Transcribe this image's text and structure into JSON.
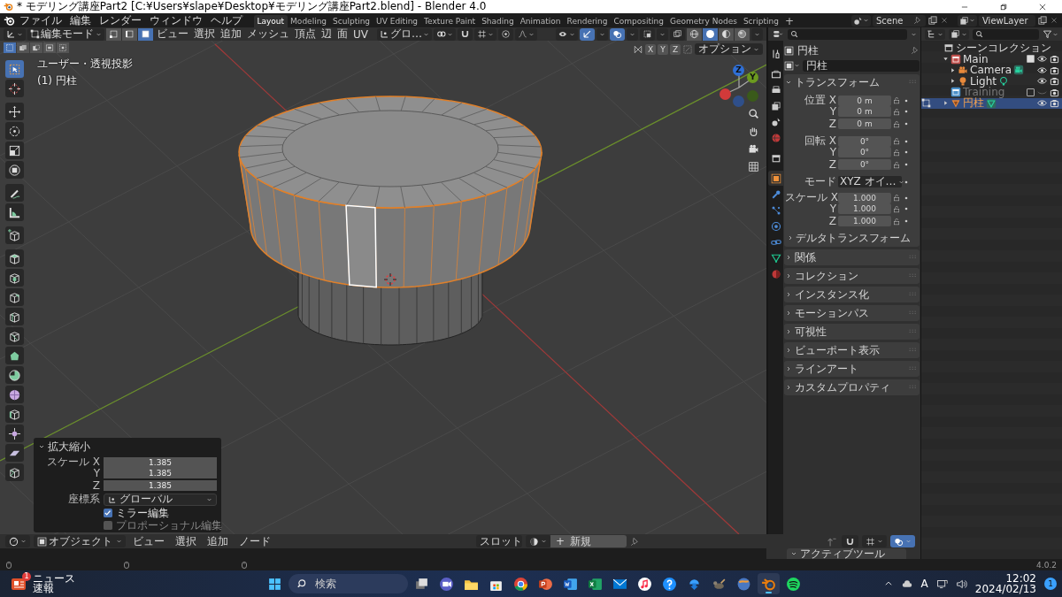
{
  "window": {
    "title": "* モデリング講座Part2 [C:¥Users¥slape¥Desktop¥モデリング講座Part2.blend] - Blender 4.0"
  },
  "menu": [
    "ファイル",
    "編集",
    "レンダー",
    "ウィンドウ",
    "ヘルプ"
  ],
  "workspaces": [
    {
      "label": "Layout",
      "selected": true
    },
    {
      "label": "Modeling",
      "selected": false
    },
    {
      "label": "Sculpting",
      "selected": false
    },
    {
      "label": "UV Editing",
      "selected": false
    },
    {
      "label": "Texture Paint",
      "selected": false
    },
    {
      "label": "Shading",
      "selected": false
    },
    {
      "label": "Animation",
      "selected": false
    },
    {
      "label": "Rendering",
      "selected": false
    },
    {
      "label": "Compositing",
      "selected": false
    },
    {
      "label": "Geometry Nodes",
      "selected": false
    },
    {
      "label": "Scripting",
      "selected": false
    }
  ],
  "add_workspace": "+",
  "scene": {
    "name": "Scene"
  },
  "view_layer": {
    "name": "ViewLayer"
  },
  "viewport_header": {
    "mode": "編集モード",
    "select_modes": [
      {
        "kind": "vertex",
        "selected": false
      },
      {
        "kind": "edge",
        "selected": false
      },
      {
        "kind": "face",
        "selected": true
      }
    ],
    "menus": [
      "ビュー",
      "選択",
      "追加",
      "メッシュ",
      "頂点",
      "辺",
      "面",
      "UV"
    ],
    "orientation": "グロ…",
    "left_toggles": [
      {
        "kind": "snap",
        "on": false
      },
      {
        "kind": "proportional",
        "on": false
      }
    ],
    "right_toggles": [
      {
        "kind": "gizmo",
        "on": true
      },
      {
        "kind": "overlay",
        "on": true
      },
      {
        "kind": "mesh_overlay",
        "on": false
      },
      {
        "kind": "xray",
        "on": false
      }
    ],
    "shading": [
      {
        "kind": "wireframe",
        "selected": false
      },
      {
        "kind": "solid",
        "selected": true
      },
      {
        "kind": "material",
        "selected": false
      },
      {
        "kind": "rendered",
        "selected": false
      }
    ],
    "box_modes": [
      {
        "kind": "set",
        "selected": true
      },
      {
        "kind": "extend",
        "selected": false
      },
      {
        "kind": "subtract",
        "selected": false
      },
      {
        "kind": "invert",
        "selected": false
      },
      {
        "kind": "intersect",
        "selected": false
      }
    ],
    "mirror_axes": [
      {
        "label": "X",
        "on": false
      },
      {
        "label": "Y",
        "on": false
      },
      {
        "label": "Z",
        "on": false
      }
    ],
    "options": "オプション"
  },
  "viewport": {
    "view_name": "ユーザー・透視投影",
    "object_label": "(1) 円柱",
    "gizmo_labels": [
      "Z",
      "Y"
    ]
  },
  "tool_groups": [
    [
      {
        "kind": "select_box",
        "selected": true
      },
      {
        "kind": "cursor",
        "selected": false
      }
    ],
    [
      {
        "kind": "move",
        "selected": false
      },
      {
        "kind": "rotate",
        "selected": false
      },
      {
        "kind": "scale",
        "selected": false
      },
      {
        "kind": "transform",
        "selected": false
      }
    ],
    [
      {
        "kind": "annotate",
        "selected": false
      },
      {
        "kind": "measure",
        "selected": false
      }
    ],
    [
      {
        "kind": "add_cube",
        "selected": false
      }
    ],
    [
      {
        "kind": "extrude",
        "selected": false
      },
      {
        "kind": "inset",
        "selected": false
      },
      {
        "kind": "bevel",
        "selected": false
      },
      {
        "kind": "loop_cut",
        "selected": false
      },
      {
        "kind": "knife",
        "selected": false
      },
      {
        "kind": "poly_build",
        "selected": false
      },
      {
        "kind": "spin",
        "selected": false
      },
      {
        "kind": "smooth",
        "selected": false
      },
      {
        "kind": "edge_slide",
        "selected": false
      },
      {
        "kind": "shrink",
        "selected": false
      },
      {
        "kind": "shear",
        "selected": false
      },
      {
        "kind": "rip",
        "selected": false
      }
    ]
  ],
  "operator_panel": {
    "title": "拡大縮小",
    "fields": [
      {
        "label": "スケール X",
        "value": "1.385"
      },
      {
        "label": "Y",
        "value": "1.385"
      },
      {
        "label": "Z",
        "value": "1.385"
      }
    ],
    "orientation_label": "座標系",
    "orientation": "グローバル",
    "checks": [
      {
        "label": "ミラー編集",
        "checked": true
      },
      {
        "label": "プロポーショナル編集",
        "checked": false
      }
    ]
  },
  "properties": {
    "tab_groups": [
      [
        {
          "kind": "tool",
          "selected": false
        }
      ],
      [
        {
          "kind": "render",
          "selected": false
        },
        {
          "kind": "output",
          "selected": false
        },
        {
          "kind": "view_layer",
          "selected": false
        },
        {
          "kind": "scene",
          "selected": false
        },
        {
          "kind": "world",
          "selected": false
        }
      ],
      [
        {
          "kind": "collection",
          "selected": false
        }
      ],
      [
        {
          "kind": "object",
          "selected": true
        },
        {
          "kind": "modifier",
          "selected": false
        },
        {
          "kind": "particles",
          "selected": false
        },
        {
          "kind": "physics",
          "selected": false
        },
        {
          "kind": "constraints",
          "selected": false
        },
        {
          "kind": "data",
          "selected": false
        },
        {
          "kind": "material",
          "selected": false
        }
      ]
    ],
    "object_name": "円柱",
    "datablock": "円柱",
    "transform_title": "トランスフォーム",
    "row_groups": [
      [
        {
          "kind": "number",
          "label": "位置 X",
          "value": "0 m"
        },
        {
          "kind": "number",
          "label": "Y",
          "value": "0 m"
        },
        {
          "kind": "number",
          "label": "Z",
          "value": "0 m"
        }
      ],
      [
        {
          "kind": "number",
          "label": "回転 X",
          "value": "0°"
        },
        {
          "kind": "number",
          "label": "Y",
          "value": "0°"
        },
        {
          "kind": "number",
          "label": "Z",
          "value": "0°"
        }
      ],
      [
        {
          "kind": "dropdown",
          "label": "モード",
          "value": "XYZ オイ…"
        }
      ],
      [
        {
          "kind": "number",
          "label": "スケール X",
          "value": "1.000"
        },
        {
          "kind": "number",
          "label": "Y",
          "value": "1.000"
        },
        {
          "kind": "number",
          "label": "Z",
          "value": "1.000"
        }
      ]
    ],
    "subpanel": "デルタトランスフォーム",
    "panels": [
      "関係",
      "コレクション",
      "インスタンス化",
      "モーションパス",
      "可視性",
      "ビューポート表示",
      "ラインアート",
      "カスタムプロパティ"
    ]
  },
  "outliner": {
    "items": [
      {
        "label": "シーンコレクション",
        "kind": "scene_collection",
        "selected": false,
        "children": [
          {
            "label": "Main",
            "kind": "collection",
            "color": "#c0504d",
            "expanded": true,
            "checked": true,
            "disabled": false,
            "selected": false,
            "children": [
              {
                "label": "Camera",
                "kind": "camera",
                "expanded": false,
                "editing": false,
                "selected": false
              },
              {
                "label": "Light",
                "kind": "light",
                "expanded": false,
                "editing": false,
                "selected": false
              }
            ]
          },
          {
            "label": "Training",
            "kind": "collection",
            "color": "#4a8fc7",
            "checked": false,
            "disabled": true,
            "selected": false
          },
          {
            "label": "円柱",
            "kind": "mesh",
            "expanded": false,
            "editing": true,
            "selected": true
          }
        ]
      }
    ]
  },
  "shader_header": {
    "mode": "オブジェクト",
    "menus": [
      "ビュー",
      "選択",
      "追加",
      "ノード"
    ],
    "slot": "スロット",
    "new_icon": "+",
    "new_label": "新規"
  },
  "sidebar_panel": "アクティブツール",
  "status_bar": {
    "version": "4.0.2"
  },
  "taskbar": {
    "news": {
      "badge": "1",
      "title": "ニュース",
      "subtitle": "速報"
    },
    "items": [
      {
        "kind": "start",
        "selected": false
      },
      {
        "kind": "search",
        "placeholder": "検索",
        "selected": false
      },
      {
        "kind": "task_view",
        "selected": false
      },
      {
        "kind": "meet",
        "selected": false
      },
      {
        "kind": "explorer",
        "selected": false
      },
      {
        "kind": "store",
        "selected": false
      },
      {
        "kind": "chrome",
        "selected": false
      },
      {
        "kind": "powerpoint",
        "selected": false
      },
      {
        "kind": "word",
        "selected": false
      },
      {
        "kind": "excel",
        "selected": false
      },
      {
        "kind": "mail",
        "selected": false
      },
      {
        "kind": "music",
        "selected": false
      },
      {
        "kind": "help",
        "selected": false
      },
      {
        "kind": "download",
        "selected": false
      },
      {
        "kind": "gimp",
        "selected": false
      },
      {
        "kind": "browser",
        "selected": false
      },
      {
        "kind": "blender",
        "selected": true
      },
      {
        "kind": "spotify",
        "selected": false
      }
    ],
    "ime": "A",
    "time": "12:02",
    "date": "2024/02/13",
    "notifications": "1"
  }
}
